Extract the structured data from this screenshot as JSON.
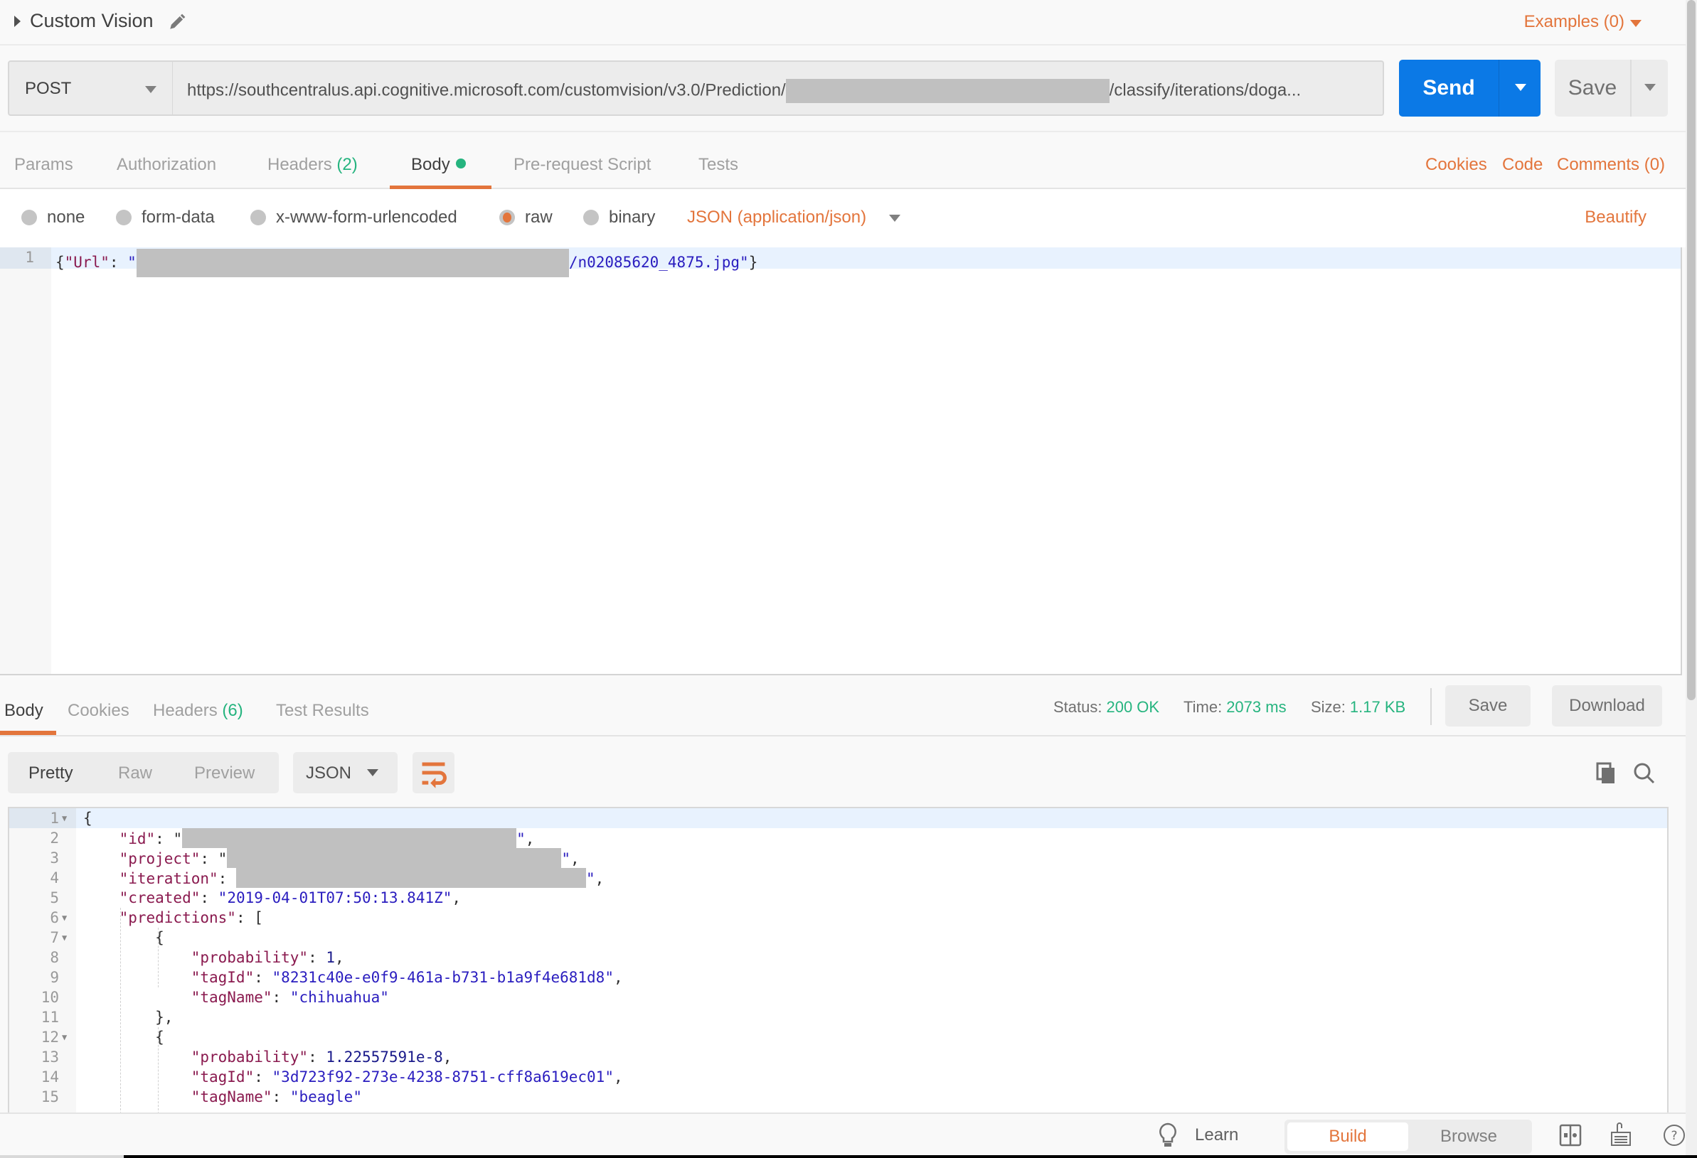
{
  "header": {
    "title": "Custom Vision",
    "examples_label": "Examples (0)"
  },
  "request": {
    "method": "POST",
    "url_prefix": "https://southcentralus.api.cognitive.microsoft.com/customvision/v3.0/Prediction/",
    "url_suffix": "/classify/iterations/doga...",
    "send_label": "Send",
    "save_label": "Save"
  },
  "request_tabs": [
    {
      "label": "Params"
    },
    {
      "label": "Authorization"
    },
    {
      "label": "Headers",
      "count": "(2)"
    },
    {
      "label": "Body",
      "active": true
    },
    {
      "label": "Pre-request Script"
    },
    {
      "label": "Tests"
    }
  ],
  "request_links": {
    "cookies": "Cookies",
    "code": "Code",
    "comments": "Comments (0)"
  },
  "body_types": {
    "none": "none",
    "form_data": "form-data",
    "urlencoded": "x-www-form-urlencoded",
    "raw": "raw",
    "binary": "binary",
    "selected": "raw",
    "content_type": "JSON (application/json)",
    "beautify": "Beautify"
  },
  "request_body": {
    "line_number": "1",
    "key": "\"Url\"",
    "sep": ": ",
    "value_start": "\"",
    "value_end": "/n02085620_4875.jpg\"",
    "open": "{",
    "close": "}"
  },
  "response_tabs": {
    "body": "Body",
    "cookies": "Cookies",
    "headers": "Headers",
    "headers_count": "(6)",
    "test_results": "Test Results"
  },
  "response_meta": {
    "status_label": "Status:",
    "status_value": "200 OK",
    "time_label": "Time:",
    "time_value": "2073 ms",
    "size_label": "Size:",
    "size_value": "1.17 KB",
    "save_label": "Save",
    "download_label": "Download"
  },
  "response_toolbar": {
    "pretty": "Pretty",
    "raw": "Raw",
    "preview": "Preview",
    "language": "JSON"
  },
  "response_lines": [
    {
      "n": "1",
      "fold": true,
      "html": "<span class='p'>{</span>"
    },
    {
      "n": "2",
      "html": "    <span class='k'>\"id\"</span><span class='p'>: \"</span><span class='redact' style='width:470px;height:28px'></span><span class='s'>\"</span><span class='p'>,</span>"
    },
    {
      "n": "3",
      "html": "    <span class='k'>\"project\"</span><span class='p'>: \"</span><span class='redact' style='width:470px;height:28px'></span><span class='s'>\"</span><span class='p'>,</span>"
    },
    {
      "n": "4",
      "html": "    <span class='k'>\"iteration\"</span><span class='p'>: </span><span class='redact' style='width:492px;height:28px'></span><span class='s'>\"</span><span class='p'>,</span>"
    },
    {
      "n": "5",
      "html": "    <span class='k'>\"created\"</span><span class='p'>: </span><span class='s'>\"2019-04-01T07:50:13.841Z\"</span><span class='p'>,</span>"
    },
    {
      "n": "6",
      "fold": true,
      "html": "    <span class='k'>\"predictions\"</span><span class='p'>: [</span>"
    },
    {
      "n": "7",
      "fold": true,
      "html": "        <span class='p'>{</span>"
    },
    {
      "n": "8",
      "html": "            <span class='k'>\"probability\"</span><span class='p'>: </span><span class='n'>1</span><span class='p'>,</span>"
    },
    {
      "n": "9",
      "html": "            <span class='k'>\"tagId\"</span><span class='p'>: </span><span class='s'>\"8231c40e-e0f9-461a-b731-b1a9f4e681d8\"</span><span class='p'>,</span>"
    },
    {
      "n": "10",
      "html": "            <span class='k'>\"tagName\"</span><span class='p'>: </span><span class='s'>\"chihuahua\"</span>"
    },
    {
      "n": "11",
      "html": "        <span class='p'>},</span>"
    },
    {
      "n": "12",
      "fold": true,
      "html": "        <span class='p'>{</span>"
    },
    {
      "n": "13",
      "html": "            <span class='k'>\"probability\"</span><span class='p'>: </span><span class='n'>1.22557591e-8</span><span class='p'>,</span>"
    },
    {
      "n": "14",
      "html": "            <span class='k'>\"tagId\"</span><span class='p'>: </span><span class='s'>\"3d723f92-273e-4238-8751-cff8a619ec01\"</span><span class='p'>,</span>"
    },
    {
      "n": "15",
      "html": "            <span class='k'>\"tagName\"</span><span class='p'>: </span><span class='s'>\"beagle\"</span>"
    }
  ],
  "footer": {
    "learn": "Learn",
    "build": "Build",
    "browse": "Browse"
  },
  "colors": {
    "accent": "#e3753c",
    "send_blue": "#0b79e6",
    "success_green": "#26b47f"
  }
}
